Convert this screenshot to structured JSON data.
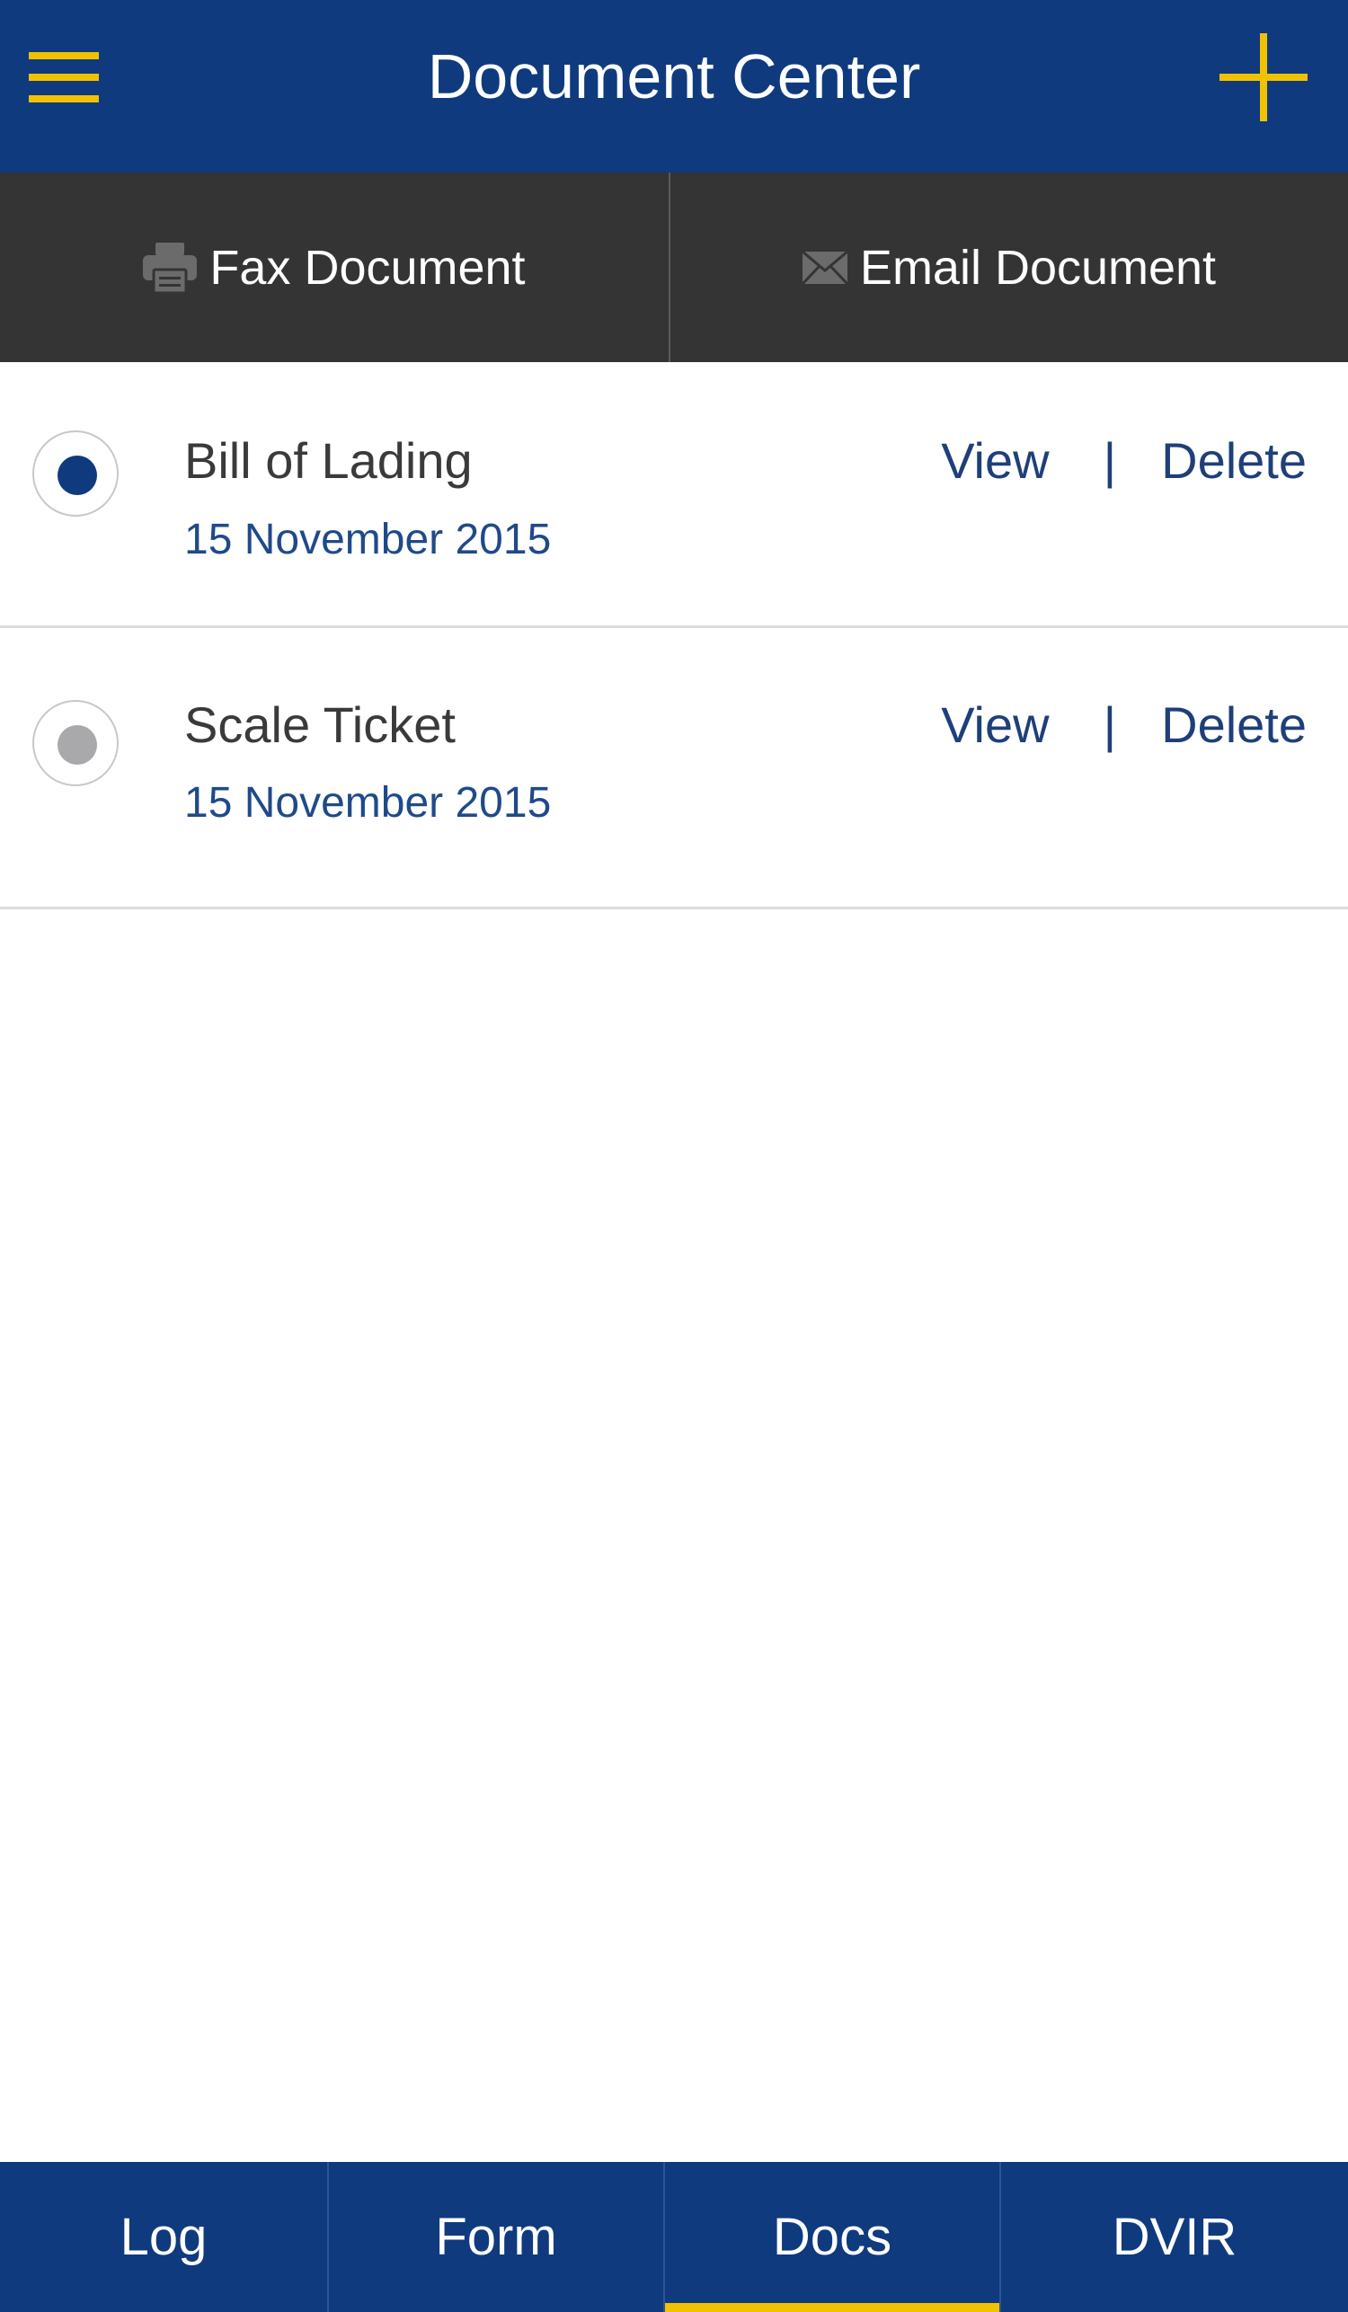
{
  "header": {
    "title": "Document Center",
    "menu_icon": "hamburger-menu-icon",
    "add_icon": "plus-icon"
  },
  "actions": {
    "fax": {
      "label": "Fax Document",
      "icon": "printer-icon"
    },
    "email": {
      "label": "Email Document",
      "icon": "envelope-icon"
    }
  },
  "documents": [
    {
      "name": "Bill of Lading",
      "date": "15 November 2015",
      "selected": true
    },
    {
      "name": "Scale Ticket",
      "date": "15 November 2015",
      "selected": false
    }
  ],
  "row_actions": {
    "view_label": "View",
    "separator": "|",
    "delete_label": "Delete"
  },
  "tabs": [
    {
      "label": "Log",
      "active": false
    },
    {
      "label": "Form",
      "active": false
    },
    {
      "label": "Docs",
      "active": true
    },
    {
      "label": "DVIR",
      "active": false
    }
  ],
  "colors": {
    "brand_blue": "#0f3a7e",
    "accent_yellow": "#f2c200",
    "action_bar": "#343434",
    "radio_selected": "#0f3a7e",
    "radio_unselected": "#a9a9ab"
  }
}
